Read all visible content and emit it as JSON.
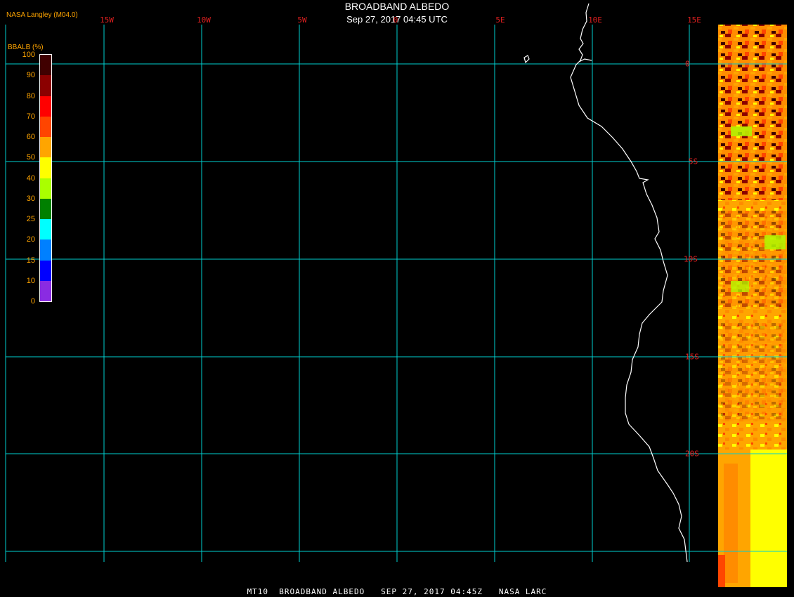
{
  "header": {
    "title": "BROADBAND ALBEDO",
    "subtitle": "Sep 27, 2017 04:45 UTC",
    "producer": "NASA Langley (M04.0)"
  },
  "longitude_labels": [
    "15W",
    "10W",
    "5W",
    "0",
    "5E",
    "10E",
    "15E"
  ],
  "latitude_labels": [
    "0",
    "5S",
    "10S",
    "15S",
    "20S"
  ],
  "colorbar": {
    "title": "BBALB (%)",
    "tick_labels": [
      "100",
      "90",
      "80",
      "70",
      "60",
      "50",
      "40",
      "30",
      "25",
      "20",
      "15",
      "10",
      "0"
    ],
    "colors": [
      "#400000",
      "#8b0000",
      "#ff0000",
      "#ff4500",
      "#ffa500",
      "#ffff00",
      "#aaff00",
      "#008000",
      "#00ffff",
      "#0080ff",
      "#0000ff",
      "#8a2be2"
    ]
  },
  "footer": "MT10  BROADBAND ALBEDO   SEP 27, 2017 04:45Z   NASA LARC",
  "colors": {
    "grid": "#00d0d0",
    "coast": "#ffffff",
    "label": "#e02020",
    "accent": "#ffa500"
  }
}
